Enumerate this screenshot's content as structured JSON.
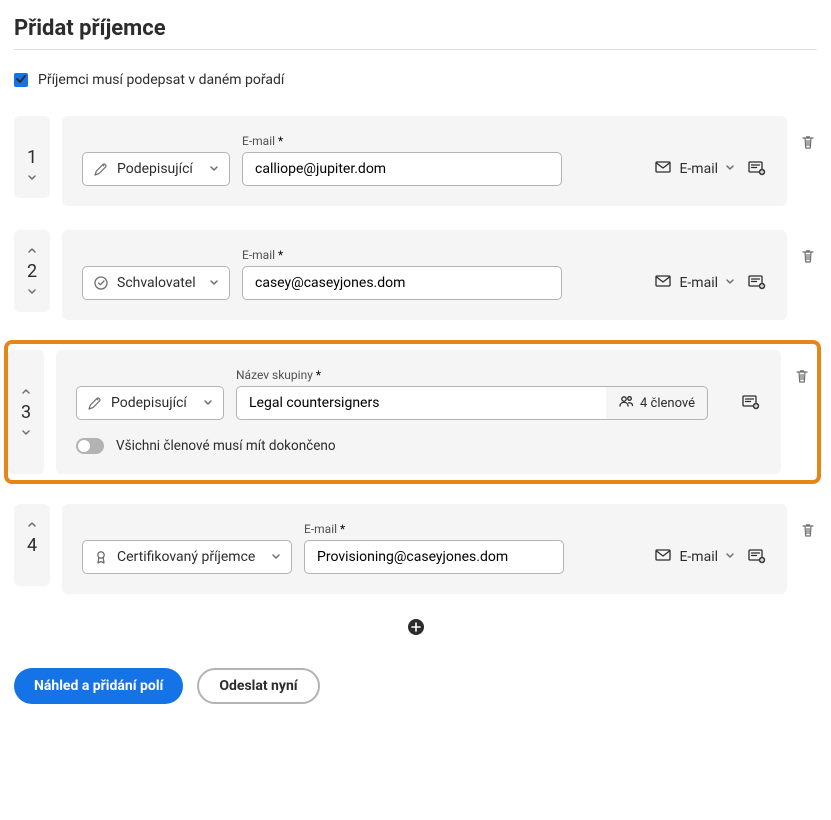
{
  "title": "Přidat příjemce",
  "order_checkbox_label": "Příjemci musí podepsat v daném pořadí",
  "labels": {
    "email": "E-mail",
    "group_name": "Název skupiny",
    "delivery_email": "E-mail"
  },
  "roles": {
    "signer": "Podepisující",
    "approver": "Schvalovatel",
    "certified": "Certifikovaný příjemce"
  },
  "recipients": [
    {
      "order": "1",
      "email": "calliope@jupiter.dom"
    },
    {
      "order": "2",
      "email": "casey@caseyjones.dom"
    },
    {
      "order": "3",
      "group_name": "Legal countersigners",
      "members_label": "4 členové",
      "toggle_label": "Všichni členové musí mít dokončeno"
    },
    {
      "order": "4",
      "email": "Provisioning@caseyjones.dom"
    }
  ],
  "footer": {
    "preview": "Náhled a přidání polí",
    "send": "Odeslat nyní"
  }
}
